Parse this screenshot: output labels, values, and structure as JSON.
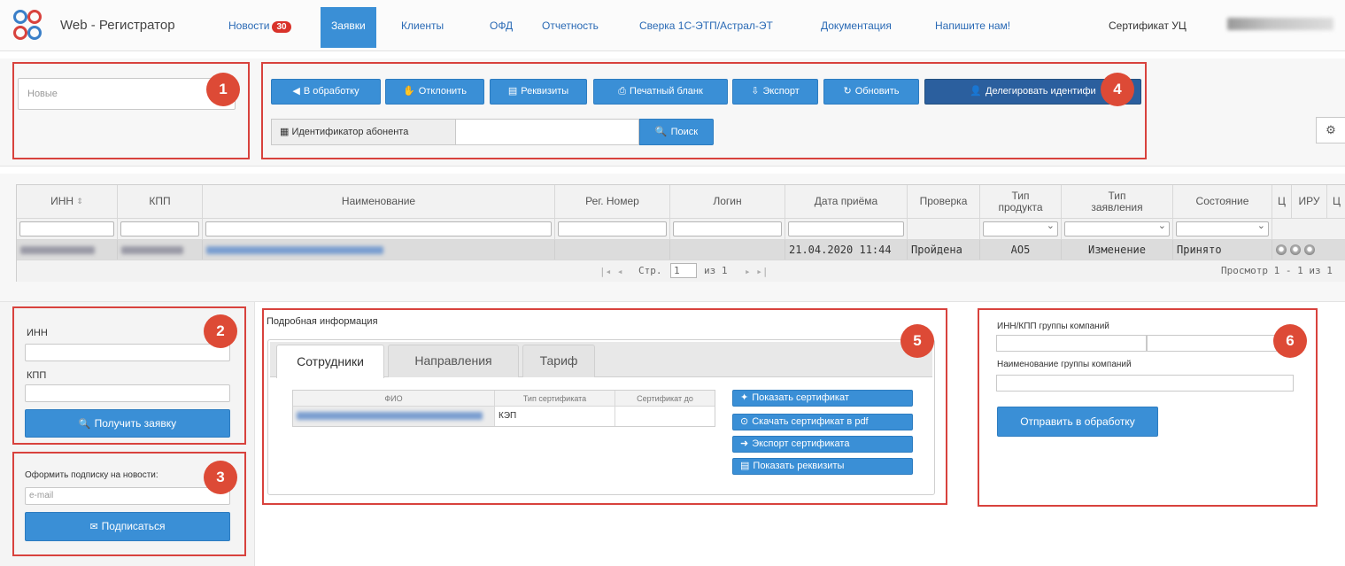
{
  "nav": {
    "brand": "Web - Регистратор",
    "news": "Новости",
    "news_count": "30",
    "items": [
      "Заявки",
      "Клиенты",
      "ОФД",
      "Отчетность",
      "Сверка 1С-ЭТП/Астрал-ЭТ",
      "Документация",
      "Напишите нам!"
    ],
    "cert": "Сертификат УЦ"
  },
  "callouts": [
    "1",
    "2",
    "3",
    "4",
    "5",
    "6"
  ],
  "filter": {
    "status_value": "Новые"
  },
  "toolbar": {
    "buttons": [
      "В обработку",
      "Отклонить",
      "Реквизиты",
      "Печатный бланк",
      "Экспорт",
      "Обновить",
      "Делегировать идентифи"
    ],
    "id_label": "Идентификатор абонента",
    "search": "Поиск"
  },
  "grid": {
    "columns": [
      "ИНН",
      "КПП",
      "Наименование",
      "Рег. Номер",
      "Логин",
      "Дата приёма",
      "Проверка",
      "Тип продукта",
      "Тип заявления",
      "Состояние",
      "Ц",
      "ИРУ",
      "Ц"
    ],
    "row": {
      "date": "21.04.2020 11:44",
      "check": "Пройдена",
      "product": "АО5",
      "app_type": "Изменение",
      "state": "Принято"
    },
    "pager": {
      "page_label": "Стр.",
      "page": "1",
      "of": "из 1",
      "view": "Просмотр 1 - 1 из 1"
    }
  },
  "request_form": {
    "inn_label": "ИНН",
    "kpp_label": "КПП",
    "button": "Получить заявку"
  },
  "subscribe": {
    "label": "Оформить подписку на новости:",
    "placeholder": "e-mail",
    "button": "Подписаться"
  },
  "details": {
    "title": "Подробная информация",
    "tabs": [
      "Сотрудники",
      "Направления",
      "Тариф"
    ],
    "table_headers": [
      "ФИО",
      "Тип сертификата",
      "Сертификат до"
    ],
    "cert_type": "КЭП",
    "actions": [
      "Показать сертификат",
      "Скачать сертификат в pdf",
      "Экспорт сертификата",
      "Показать реквизиты"
    ]
  },
  "group": {
    "inn_kpp_label": "ИНН/КПП группы компаний",
    "name_label": "Наименование группы компаний",
    "button": "Отправить в обработку"
  },
  "colors": {
    "primary": "#3a8fd6",
    "dark": "#2b5f9e",
    "callout": "#dd4a36",
    "frame": "#d8423d"
  }
}
